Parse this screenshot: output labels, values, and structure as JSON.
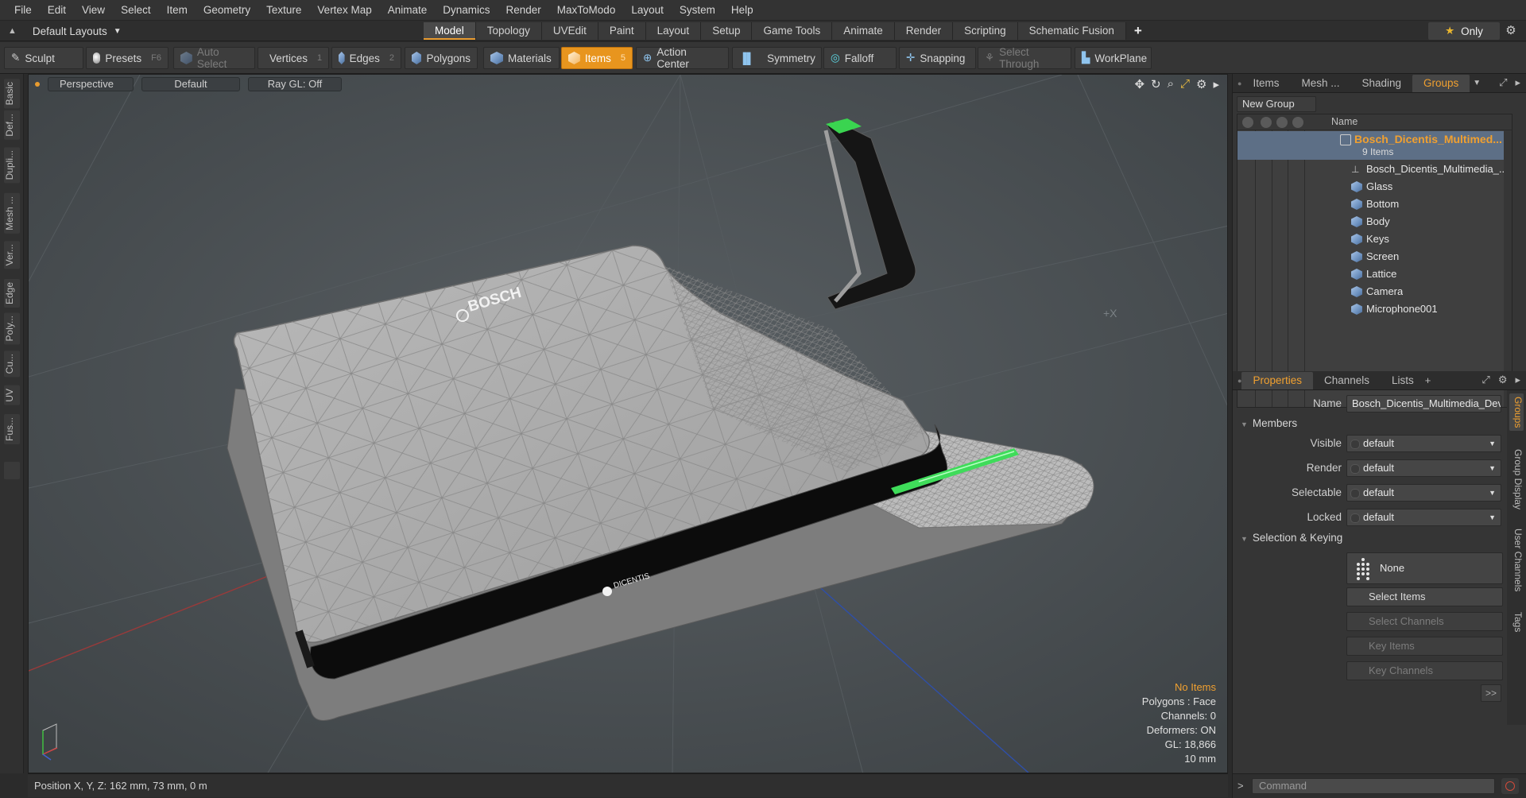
{
  "menu": [
    "File",
    "Edit",
    "View",
    "Select",
    "Item",
    "Geometry",
    "Texture",
    "Vertex Map",
    "Animate",
    "Dynamics",
    "Render",
    "MaxToModo",
    "Layout",
    "System",
    "Help"
  ],
  "layout": {
    "selector": "Default Layouts",
    "tabs": [
      "Model",
      "Topology",
      "UVEdit",
      "Paint",
      "Layout",
      "Setup",
      "Game Tools",
      "Animate",
      "Render",
      "Scripting",
      "Schematic Fusion"
    ],
    "active_tab": "Model",
    "only_label": "Only"
  },
  "toolbar": {
    "sculpt": "Sculpt",
    "presets": "Presets",
    "presets_key": "F6",
    "auto_select": "Auto Select",
    "vertices": "Vertices",
    "vertices_key": "1",
    "edges": "Edges",
    "edges_key": "2",
    "polygons": "Polygons",
    "materials": "Materials",
    "items": "Items",
    "items_key": "5",
    "action_center": "Action Center",
    "symmetry": "Symmetry",
    "falloff": "Falloff",
    "snapping": "Snapping",
    "select_through": "Select Through",
    "workplane": "WorkPlane"
  },
  "left_tabs": [
    "Basic",
    "Def...",
    "Dupli...",
    "Mesh ...",
    "Ver...",
    "Edge",
    "Poly...",
    "Cu...",
    "UV",
    "Fus..."
  ],
  "viewport": {
    "view": "Perspective",
    "shading": "Default",
    "raygl": "Ray GL: Off",
    "brand_text": "BOSCH",
    "product_text": "DICENTIS",
    "axis_label": "+X",
    "info": {
      "status": "No Items",
      "polygons": "Polygons : Face",
      "channels": "Channels: 0",
      "deformers": "Deformers: ON",
      "gl": "GL: 18,866",
      "scale": "10 mm"
    },
    "position": "Position X, Y, Z:   162 mm, 73 mm, 0 m"
  },
  "scene_panel": {
    "tabs": [
      "Items",
      "Mesh ...",
      "Shading",
      "Groups"
    ],
    "active_tab": "Groups",
    "new_group": "New Group",
    "name_col": "Name",
    "root": "Bosch_Dicentis_Multimed...",
    "root_count": "9 Items",
    "children": [
      "Bosch_Dicentis_Multimedia_...",
      "Glass",
      "Bottom",
      "Body",
      "Keys",
      "Screen",
      "Lattice",
      "Camera",
      "Microphone001"
    ]
  },
  "properties_panel": {
    "tabs": [
      "Properties",
      "Channels",
      "Lists"
    ],
    "active_tab": "Properties",
    "name_label": "Name",
    "name_value": "Bosch_Dicentis_Multimedia_Devic",
    "members_header": "Members",
    "fields": [
      {
        "label": "Visible",
        "value": "default"
      },
      {
        "label": "Render",
        "value": "default"
      },
      {
        "label": "Selectable",
        "value": "default"
      },
      {
        "label": "Locked",
        "value": "default"
      }
    ],
    "selection_header": "Selection & Keying",
    "none_label": "None",
    "select_items": "Select Items",
    "select_channels": "Select Channels",
    "key_items": "Key Items",
    "key_channels": "Key Channels",
    "more": ">>",
    "side_tabs": [
      "Groups",
      "Group Display",
      "User Channels",
      "Tags"
    ]
  },
  "command": {
    "prompt": ">",
    "placeholder": "Command"
  }
}
